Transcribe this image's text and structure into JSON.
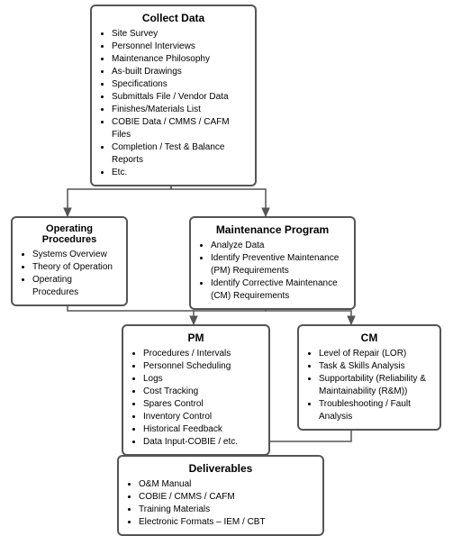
{
  "title": "Collect Data",
  "boxes": {
    "collect_data": {
      "title": "Collect Data",
      "items": [
        "Site Survey",
        "Personnel Interviews",
        "Maintenance Philosophy",
        "As-built Drawings",
        "Specifications",
        "Submittals File / Vendor Data",
        "Finishes/Materials List",
        "COBIE Data / CMMS / CAFM Files",
        "Completion / Test & Balance Reports",
        "Etc."
      ]
    },
    "operating_procedures": {
      "title": "Operating Procedures",
      "items": [
        "Systems Overview",
        "Theory of Operation",
        "Operating Procedures"
      ]
    },
    "maintenance_program": {
      "title": "Maintenance Program",
      "items": [
        "Analyze Data",
        "Identify Preventive Maintenance (PM) Requirements",
        "Identify Corrective Maintenance (CM) Requirements"
      ]
    },
    "pm": {
      "title": "PM",
      "items": [
        "Procedures / Intervals",
        "Personnel Scheduling",
        "Logs",
        "Cost Tracking",
        "Spares Control",
        "Inventory Control",
        "Historical Feedback",
        "Data Input-COBIE / etc."
      ]
    },
    "cm": {
      "title": "CM",
      "items": [
        "Level of Repair (LOR)",
        "Task & Skills Analysis",
        "Supportability (Reliability & Maintainability (R&M))",
        "Troubleshooting / Fault Analysis"
      ]
    },
    "deliverables": {
      "title": "Deliverables",
      "items": [
        "O&M Manual",
        "COBIE / CMMS / CAFM",
        "Training Materials",
        "Electronic Formats – IEM / CBT"
      ]
    }
  }
}
